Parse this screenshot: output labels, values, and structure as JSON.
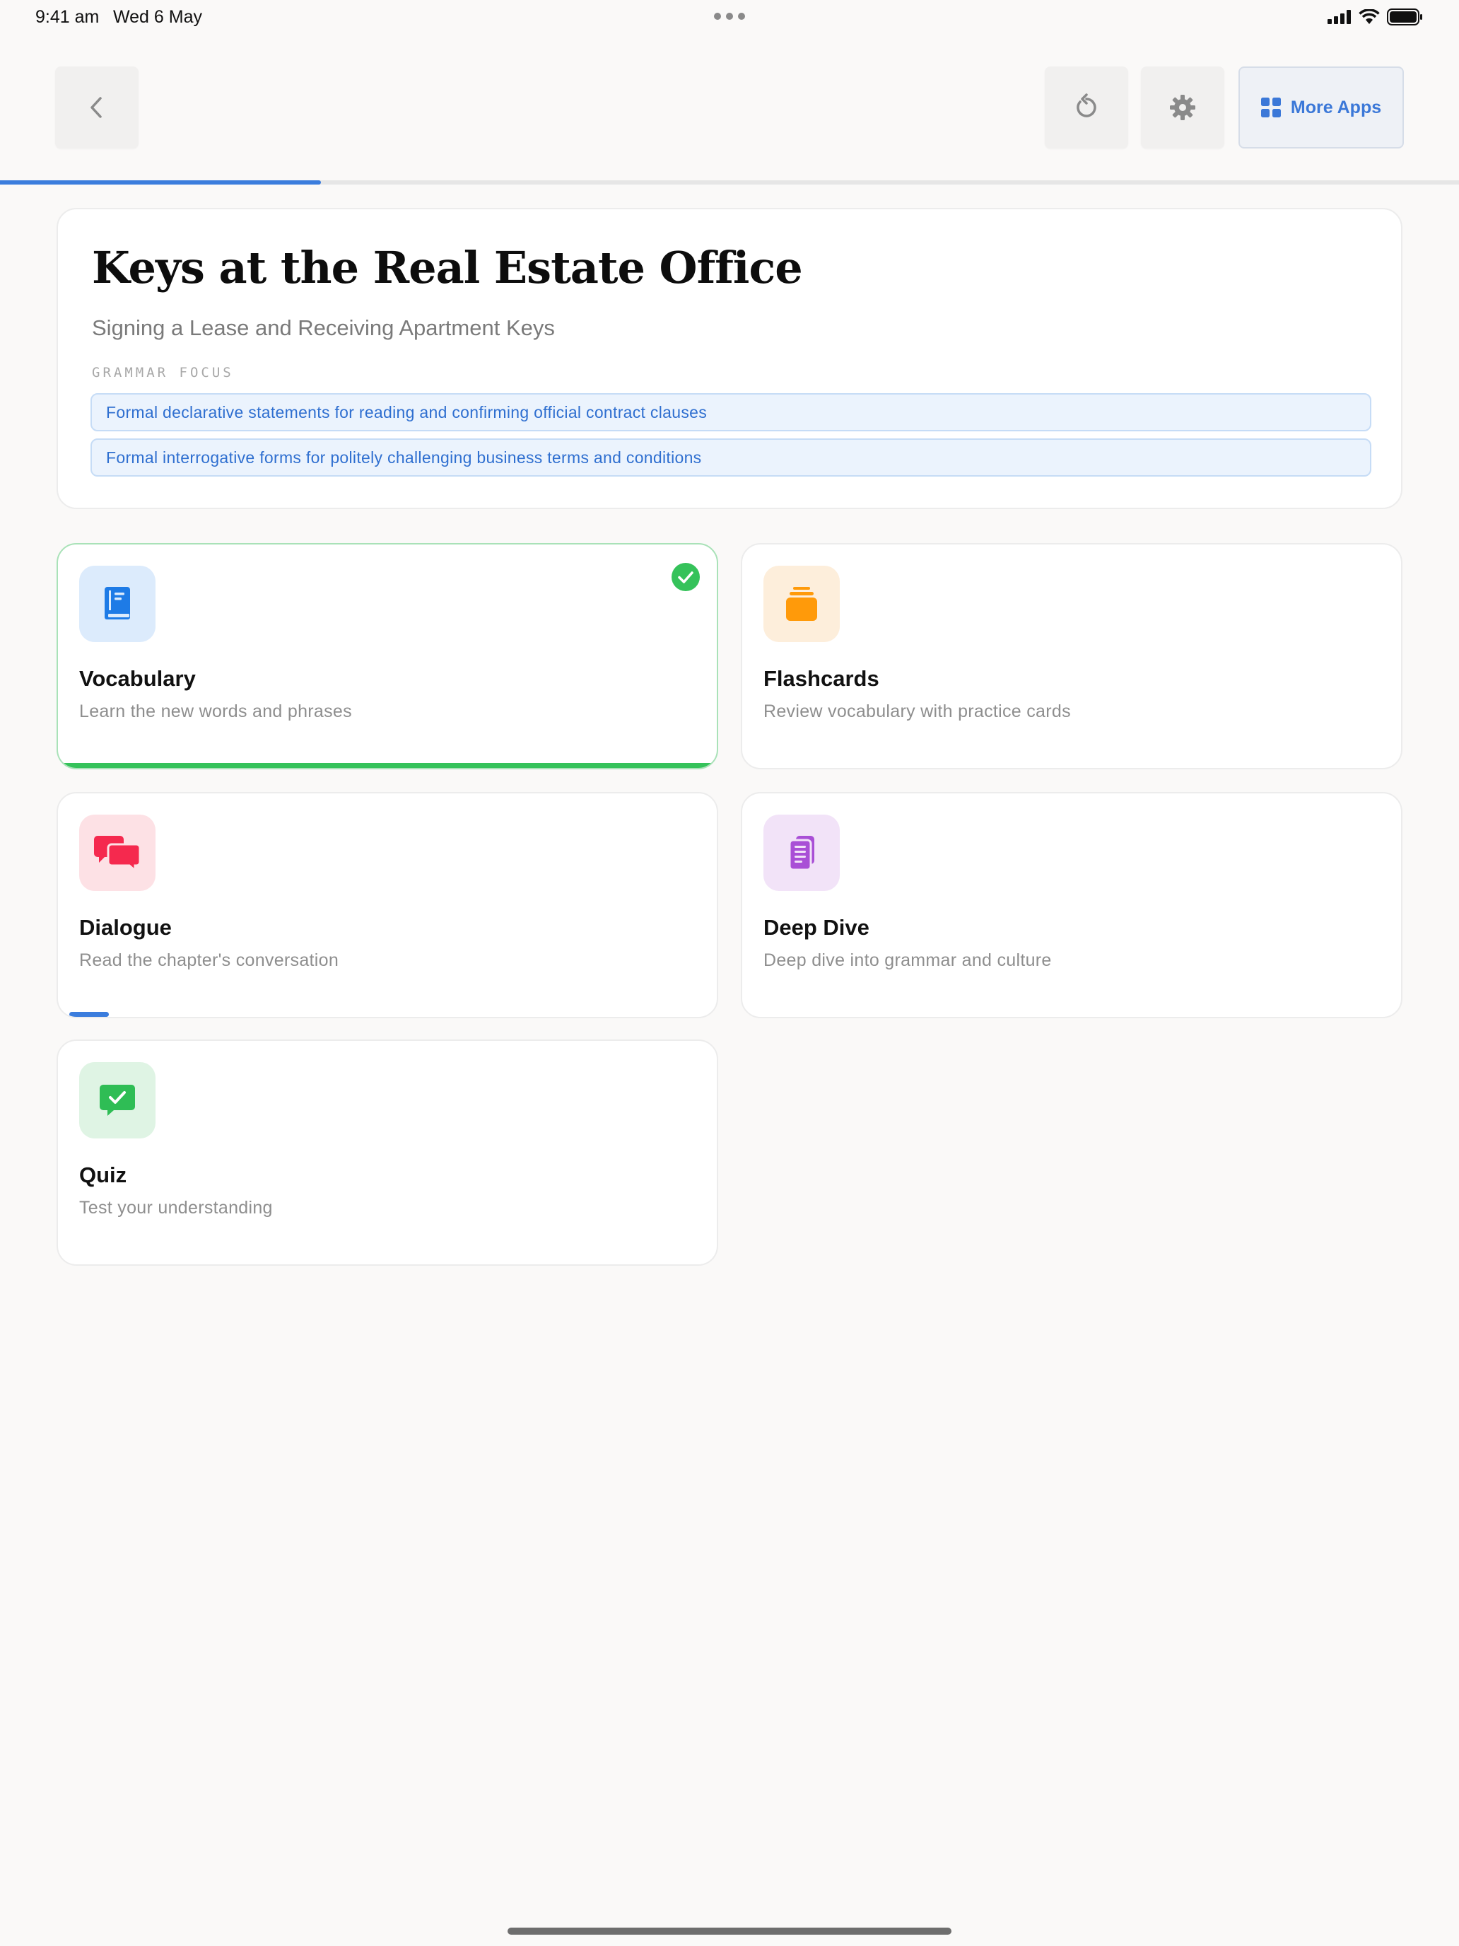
{
  "status_bar": {
    "time": "9:41 am",
    "date": "Wed 6 May"
  },
  "toolbar": {
    "back_icon": "chevron-left-icon",
    "reset_icon": "rotate-ccw-icon",
    "settings_icon": "gear-icon",
    "more_apps_label": "More Apps",
    "more_apps_icon": "grid-icon"
  },
  "progress": {
    "fraction": 0.22
  },
  "chapter": {
    "title": "Keys at the Real Estate Office",
    "subtitle": "Signing a Lease and Receiving Apartment Keys",
    "grammar_label": "GRAMMAR FOCUS",
    "grammar_points": [
      "Formal declarative statements for reading and confirming official contract clauses",
      "Formal interrogative forms for politely challenging business terms and conditions"
    ]
  },
  "activities": [
    {
      "title": "Vocabulary",
      "description": "Learn the new words and phrases",
      "icon": "book-icon",
      "completed": true,
      "progress": 1.0,
      "color": "#1e7be6",
      "bg": "#dcebfc"
    },
    {
      "title": "Flashcards",
      "description": "Review vocabulary with practice cards",
      "icon": "cards-stack-icon",
      "completed": false,
      "progress": 0,
      "color": "#ff9a0a",
      "bg": "#fdeedb"
    },
    {
      "title": "Dialogue",
      "description": "Read the chapter's conversation",
      "icon": "chat-bubbles-icon",
      "completed": false,
      "progress": 0.06,
      "color": "#f5294e",
      "bg": "#fde1e5"
    },
    {
      "title": "Deep Dive",
      "description": "Deep dive into grammar and culture",
      "icon": "document-icon",
      "completed": false,
      "progress": 0,
      "color": "#a94fd6",
      "bg": "#f2e3f8"
    },
    {
      "title": "Quiz",
      "description": "Test your understanding",
      "icon": "check-message-icon",
      "completed": false,
      "progress": 0,
      "color": "#2fbd55",
      "bg": "#dff4e4"
    }
  ],
  "colors": {
    "accent": "#3b7ddd",
    "success": "#35c25a"
  }
}
